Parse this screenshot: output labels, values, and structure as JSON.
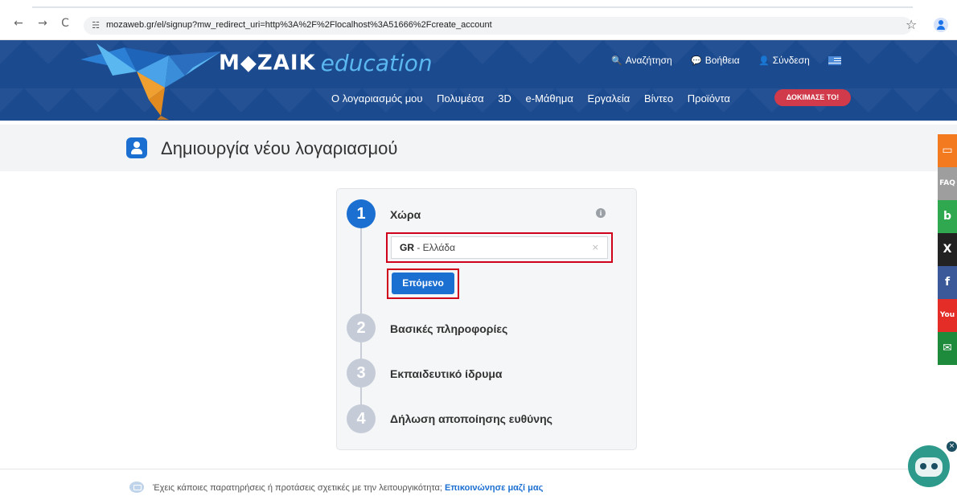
{
  "browser": {
    "url": "mozaweb.gr/el/signup?mw_redirect_uri=http%3A%2F%2Flocalhost%3A51666%2Fcreate_account",
    "back_glyph": "←",
    "forward_glyph": "→",
    "reload_glyph": "C",
    "site_info_glyph": "☵",
    "star_glyph": "☆"
  },
  "header": {
    "logo_brand": "M◆ZAIK",
    "logo_product": "education",
    "top_links": [
      {
        "label": "Αναζήτηση",
        "icon": "search-icon",
        "glyph": "🔍"
      },
      {
        "label": "Βοήθεια",
        "icon": "help-bubble-icon",
        "glyph": "💬"
      },
      {
        "label": "Σύνδεση",
        "icon": "user-icon",
        "glyph": "👤"
      }
    ],
    "nav": [
      "Ο λογαριασμός μου",
      "Πολυμέσα",
      "3D",
      "e-Μάθημα",
      "Εργαλεία",
      "Βίντεο",
      "Προϊόντα"
    ],
    "cta_label": "ΔΟΚΙΜΑΣΕ ΤΟ!",
    "colors": {
      "background": "#1b4a8f",
      "education_text": "#5ab7f0",
      "cta": "#d03a4a"
    }
  },
  "page": {
    "title": "Δημιουργία νέου λογαριασμού"
  },
  "wizard": {
    "steps": [
      {
        "number": "1",
        "label": "Χώρα",
        "active": true
      },
      {
        "number": "2",
        "label": "Βασικές πληροφορίες",
        "active": false
      },
      {
        "number": "3",
        "label": "Εκπαιδευτικό ίδρυμα",
        "active": false
      },
      {
        "number": "4",
        "label": "Δήλωση αποποίησης ευθύνης",
        "active": false
      }
    ],
    "info_glyph": "i",
    "country_select": {
      "code": "GR",
      "separator": " - ",
      "name": "Ελλάδα",
      "clear_glyph": "×"
    },
    "next_label": "Επόμενο",
    "colors": {
      "accent": "#1b6fd1",
      "inactive": "#c5ccd8",
      "highlight": "#d0021b"
    }
  },
  "footer": {
    "text": "Έχεις κάποιες παρατηρήσεις ή προτάσεις σχετικές με την λειτουργικότητα;",
    "link": "Επικοινώνησε μαζί μας"
  },
  "social": [
    {
      "name": "feedback",
      "glyph": "▭",
      "color": "#f47a20"
    },
    {
      "name": "faq",
      "glyph": "FAQ",
      "color": "#9e9e9e"
    },
    {
      "name": "blog",
      "glyph": "b",
      "color": "#2fa84f"
    },
    {
      "name": "x",
      "glyph": "X",
      "color": "#222222"
    },
    {
      "name": "facebook",
      "glyph": "f",
      "color": "#3b5998"
    },
    {
      "name": "youtube",
      "glyph": "You",
      "color": "#e52d27"
    },
    {
      "name": "email",
      "glyph": "✉",
      "color": "#1e8a3c"
    }
  ],
  "chatbot": {
    "close_glyph": "×",
    "color": "#2e9a8c"
  }
}
